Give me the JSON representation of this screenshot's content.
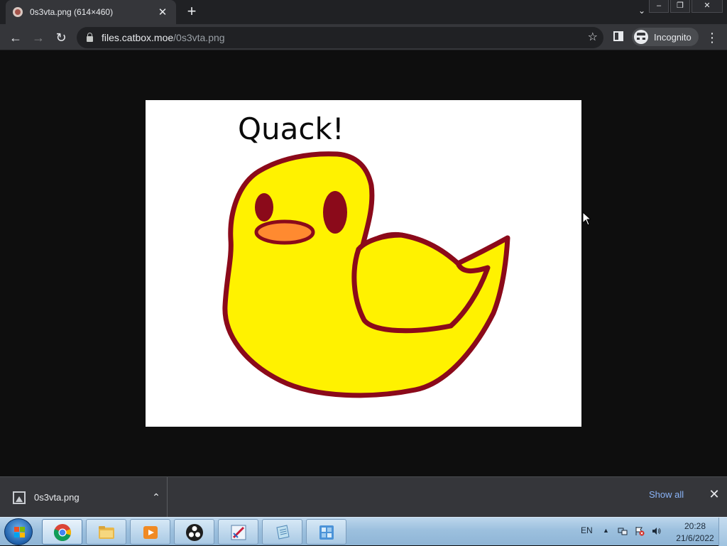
{
  "tab": {
    "title": "0s3vta.png (614×460)",
    "close": "✕"
  },
  "newtab": "+",
  "tabsearch": "⌄",
  "window": {
    "minimize": "–",
    "restore": "❐",
    "close": "✕"
  },
  "nav": {
    "back": "←",
    "forward": "→",
    "reload": "↻"
  },
  "url": {
    "host": "files.catbox.moe",
    "path": "/0s3vta.png"
  },
  "bookmark_star": "☆",
  "incognito": {
    "label": "Incognito"
  },
  "menu": "⋮",
  "image": {
    "caption": "Quack!",
    "colors": {
      "body": "#fff200",
      "outline": "#8b0a1a",
      "beak": "#ff8a30"
    }
  },
  "download": {
    "file": "0s3vta.png",
    "chevron": "⌃",
    "show_all": "Show all",
    "close": "✕"
  },
  "tray": {
    "language": "EN",
    "arrow": "▲",
    "time": "20:28",
    "date": "21/6/2022"
  }
}
